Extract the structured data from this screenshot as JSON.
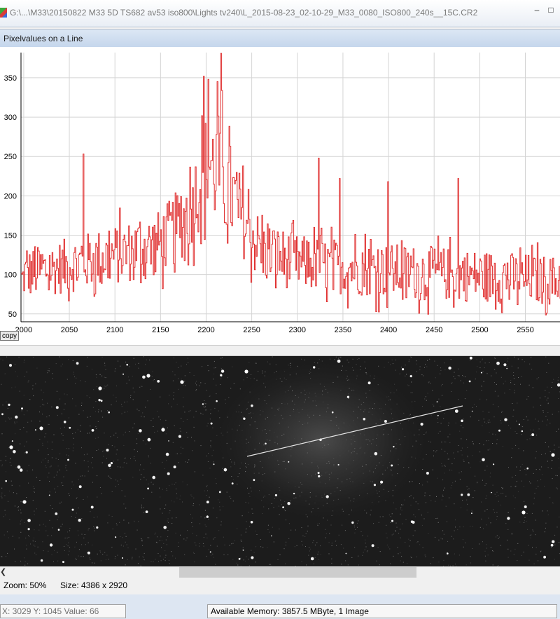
{
  "window": {
    "title": "G:\\...\\M33\\20150822 M33 5D TS682 av53 iso800\\Lights tv240\\L_2015-08-23_02-10-29_M33_0080_ISO800_240s__15C.CR2",
    "minimize_label": "–",
    "maximize_label": "□"
  },
  "panel": {
    "title": "Pixelvalues on a Line"
  },
  "chart_data": {
    "type": "line",
    "title": "",
    "xlabel": "",
    "ylabel": "",
    "x_range": [
      1997,
      2588
    ],
    "y_range": [
      40,
      382
    ],
    "x_ticks": [
      2000,
      2050,
      2100,
      2150,
      2200,
      2250,
      2300,
      2350,
      2400,
      2450,
      2500,
      2550
    ],
    "y_ticks": [
      50,
      100,
      150,
      200,
      250,
      300,
      350
    ],
    "grid": true,
    "color": "#e03030",
    "profile": [
      {
        "x": 2000,
        "level": 100,
        "spread": 45
      },
      {
        "x": 2050,
        "level": 112,
        "spread": 50
      },
      {
        "x": 2100,
        "level": 125,
        "spread": 55
      },
      {
        "x": 2150,
        "level": 140,
        "spread": 60
      },
      {
        "x": 2180,
        "level": 175,
        "spread": 70
      },
      {
        "x": 2200,
        "level": 240,
        "spread": 95
      },
      {
        "x": 2215,
        "level": 230,
        "spread": 110
      },
      {
        "x": 2240,
        "level": 170,
        "spread": 70
      },
      {
        "x": 2260,
        "level": 130,
        "spread": 60
      },
      {
        "x": 2300,
        "level": 115,
        "spread": 50
      },
      {
        "x": 2400,
        "level": 105,
        "spread": 50
      },
      {
        "x": 2500,
        "level": 98,
        "spread": 48
      },
      {
        "x": 2588,
        "level": 92,
        "spread": 45
      }
    ],
    "spikes": [
      {
        "x": 2065,
        "y": 253
      },
      {
        "x": 2197,
        "y": 352
      },
      {
        "x": 2202,
        "y": 348
      },
      {
        "x": 2212,
        "y": 345
      },
      {
        "x": 2216,
        "y": 381
      },
      {
        "x": 2323,
        "y": 248
      },
      {
        "x": 2346,
        "y": 222
      },
      {
        "x": 2399,
        "y": 218
      },
      {
        "x": 2476,
        "y": 222
      }
    ]
  },
  "copy_button": {
    "label": "copy"
  },
  "info": {
    "zoom": "Zoom: 50%",
    "size": "Size: 4386 x 2920"
  },
  "status": {
    "coords": "X: 3029  Y: 1045  Value: 66",
    "memory": "Available Memory: 3857.5 MByte, 1 Image"
  },
  "icons": {
    "scroll_left": "chevron-left-icon",
    "app": "app-icon"
  }
}
